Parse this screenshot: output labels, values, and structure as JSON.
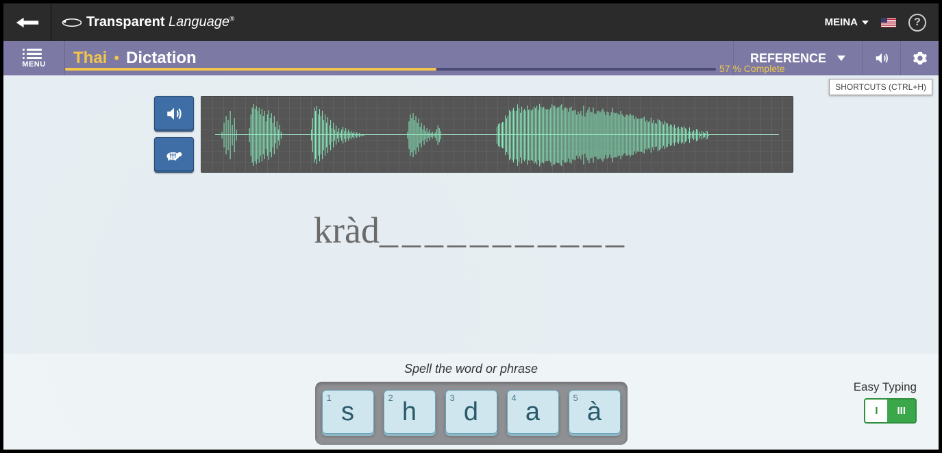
{
  "topbar": {
    "logo_bold": "Transparent",
    "logo_ital": " Language",
    "registered": "®",
    "user": "MEINA",
    "help": "?"
  },
  "subbar": {
    "menu": "MENU",
    "language": "Thai",
    "sep": "•",
    "mode": "Dictation",
    "reference": "REFERENCE"
  },
  "progress": {
    "percent": 57,
    "text": "57 % Complete"
  },
  "shortcuts": "SHORTCUTS (CTRL+H)",
  "typed": {
    "entered": "kràd",
    "blanks": "___________"
  },
  "bottom": {
    "prompt": "Spell the word or phrase",
    "keys": [
      {
        "num": "1",
        "ch": "s"
      },
      {
        "num": "2",
        "ch": "h"
      },
      {
        "num": "3",
        "ch": "d"
      },
      {
        "num": "4",
        "ch": "a"
      },
      {
        "num": "5",
        "ch": "à"
      }
    ],
    "easy_label": "Easy Typing",
    "toggle": {
      "off": "I",
      "on": "III",
      "active": "on"
    }
  }
}
